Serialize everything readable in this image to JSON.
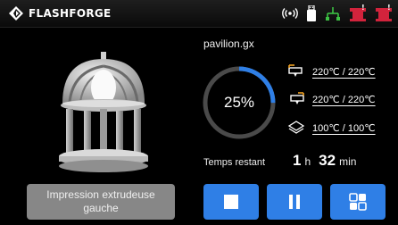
{
  "header": {
    "brand": "FLASHFORGE",
    "logo_icon": "flashforge-logo-icon",
    "status_icons": [
      "wireless-signal-icon",
      "usb-drive-icon",
      "network-status-icon",
      "filament-spool-warning-icon",
      "filament-spool-warning-icon"
    ]
  },
  "model": {
    "preview_icon": "3d-model-pavilion-icon"
  },
  "job": {
    "file_name": "pavilion.gx",
    "progress": 0.25,
    "progress_text": "25%"
  },
  "temperatures": [
    {
      "icon": "left-nozzle-icon",
      "value": "220℃ / 220℃"
    },
    {
      "icon": "right-nozzle-icon",
      "value": "220℃ / 220℃"
    },
    {
      "icon": "heated-bed-icon",
      "value": "100℃ / 100℃"
    }
  ],
  "time_remaining": {
    "label": "Temps restant",
    "hours": "1",
    "hours_unit": "h",
    "minutes": "32",
    "minutes_unit": "min"
  },
  "buttons": {
    "extruder_label": "Impression extrudeuse gauche",
    "stop_icon": "stop-icon",
    "pause_icon": "pause-icon",
    "more_icon": "more-options-icon"
  },
  "colors": {
    "accent": "#2f7fe6",
    "ring_track": "#4a4a4a",
    "warning_red": "#d2233c",
    "ok_green": "#3cc043",
    "button_gray": "#878787"
  }
}
